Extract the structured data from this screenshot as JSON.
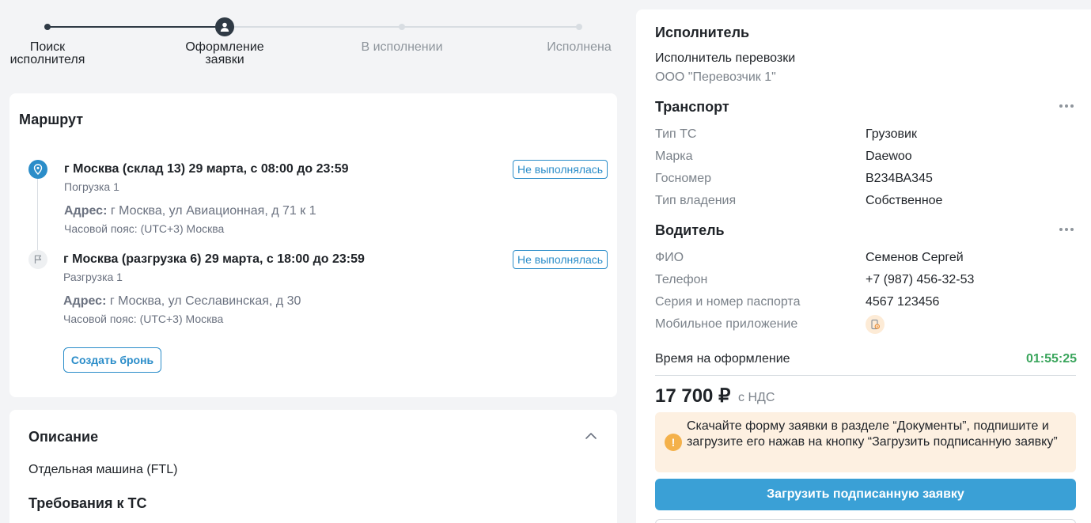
{
  "stepper": {
    "steps": [
      {
        "label": "Поиск\nисполнителя",
        "state": "done"
      },
      {
        "label": "Оформление\nзаявки",
        "state": "active"
      },
      {
        "label": "В исполнении",
        "state": "todo"
      },
      {
        "label": "Исполнена",
        "state": "todo"
      }
    ]
  },
  "route": {
    "title": "Маршрут",
    "points": [
      {
        "title": "г Москва (склад 13) 29 марта, с 08:00 до 23:59",
        "type": "Погрузка 1",
        "address_label": "Адрес:",
        "address": "г Москва, ул Авиационная, д 71 к 1",
        "timezone": "Часовой пояс: (UTC+3) Москва",
        "status": "Не выполнялась",
        "icon": "map-pin-icon"
      },
      {
        "title": "г Москва (разгрузка 6) 29 марта, с 18:00 до 23:59",
        "type": "Разгрузка 1",
        "address_label": "Адрес:",
        "address": "г Москва, ул Сеславинская, д 30",
        "timezone": "Часовой пояс: (UTC+3) Москва",
        "status": "Не выполнялась",
        "icon": "flag-icon"
      }
    ],
    "book_button": "Создать бронь"
  },
  "description": {
    "title": "Описание",
    "text": "Отдельная машина (FTL)",
    "requirements_title": "Требования к ТС"
  },
  "executor": {
    "title": "Исполнитель",
    "label": "Исполнитель перевозки",
    "value": "ООО \"Перевозчик 1\""
  },
  "transport": {
    "title": "Транспорт",
    "rows": [
      {
        "label": "Тип ТС",
        "value": "Грузовик"
      },
      {
        "label": "Марка",
        "value": "Daewoo"
      },
      {
        "label": "Госномер",
        "value": "В234ВА345"
      },
      {
        "label": "Тип владения",
        "value": "Собственное"
      }
    ]
  },
  "driver": {
    "title": "Водитель",
    "rows": [
      {
        "label": "ФИО",
        "value": "Семенов Сергей"
      },
      {
        "label": "Телефон",
        "value": "+7 (987) 456-32-53"
      },
      {
        "label": "Серия и номер паспорта",
        "value": "4567 123456"
      },
      {
        "label": "Мобильное приложение",
        "value": ""
      }
    ]
  },
  "timing": {
    "label": "Время на оформление",
    "value": "01:55:25"
  },
  "price": {
    "amount": "17 700 ₽",
    "vat": "с НДС"
  },
  "notice": {
    "text": "Скачайте форму заявки в разделе “Документы”, подпишите и загрузите его нажав на кнопку “Загрузить подписанную заявку”"
  },
  "upload_button": "Загрузить подписанную заявку",
  "colors": {
    "accent": "#2b8dc9",
    "primary_button": "#3aa0d6",
    "timer": "#3aa55c",
    "notice_bg": "#fdf0e1",
    "stepper_done": "#2f3a45"
  }
}
